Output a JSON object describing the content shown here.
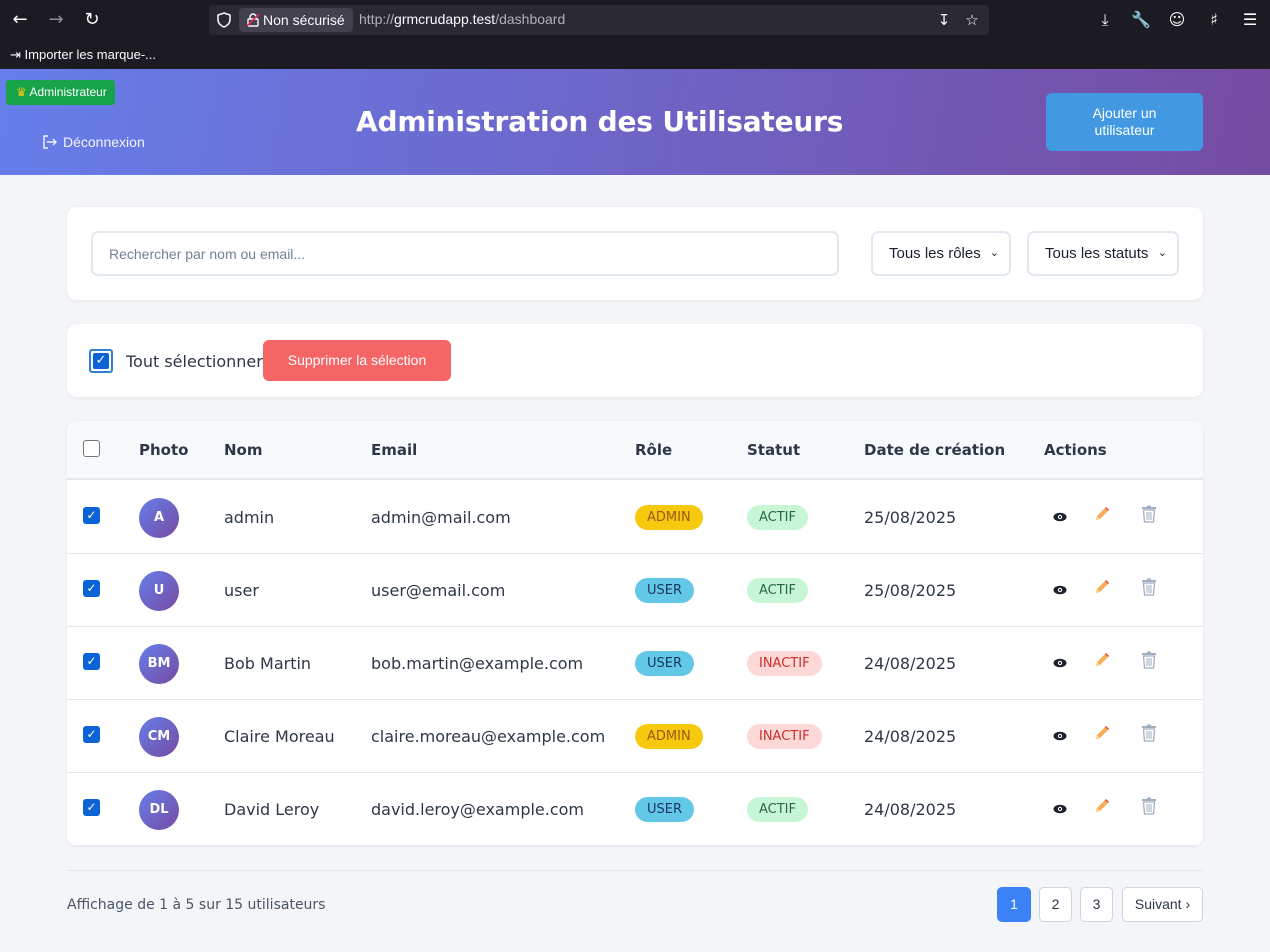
{
  "browser": {
    "insecure_label": "Non sécurisé",
    "url_prefix": "http://",
    "url_host": "grmcrudapp.test",
    "url_path": "/dashboard",
    "bookmark_label": "Importer les marque-..."
  },
  "header": {
    "badge_label": "Administrateur",
    "logout_label": "Déconnexion",
    "title": "Administration des Utilisateurs",
    "add_user_line1": "Ajouter un",
    "add_user_line2": "utilisateur"
  },
  "filters": {
    "search_placeholder": "Rechercher par nom ou email...",
    "role_select": "Tous les rôles",
    "status_select": "Tous les statuts"
  },
  "bulk": {
    "select_all_label": "Tout sélectionner",
    "delete_label": "Supprimer la sélection"
  },
  "table": {
    "headers": {
      "photo": "Photo",
      "name": "Nom",
      "email": "Email",
      "role": "Rôle",
      "status": "Statut",
      "created": "Date de création",
      "actions": "Actions"
    },
    "rows": [
      {
        "initials": "A",
        "name": "admin",
        "email": "admin@mail.com",
        "role": "ADMIN",
        "status": "ACTIF",
        "created": "25/08/2025"
      },
      {
        "initials": "U",
        "name": "user",
        "email": "user@email.com",
        "role": "USER",
        "status": "ACTIF",
        "created": "25/08/2025"
      },
      {
        "initials": "BM",
        "name": "Bob Martin",
        "email": "bob.martin@example.com",
        "role": "USER",
        "status": "INACTIF",
        "created": "24/08/2025"
      },
      {
        "initials": "CM",
        "name": "Claire Moreau",
        "email": "claire.moreau@example.com",
        "role": "ADMIN",
        "status": "INACTIF",
        "created": "24/08/2025"
      },
      {
        "initials": "DL",
        "name": "David Leroy",
        "email": "david.leroy@example.com",
        "role": "USER",
        "status": "ACTIF",
        "created": "24/08/2025"
      }
    ]
  },
  "pagination": {
    "info": "Affichage de 1 à 5 sur 15 utilisateurs",
    "pages": [
      "1",
      "2",
      "3"
    ],
    "next_label": "Suivant ›"
  },
  "colors": {
    "header_gradient_start": "#667eea",
    "header_gradient_end": "#764ba2",
    "admin_badge": "#f6c90e",
    "user_badge": "#63c7e8",
    "active_badge": "#c6f6d5",
    "inactive_badge": "#fed7d7",
    "delete_button": "#f56565",
    "primary": "#4299e1"
  }
}
